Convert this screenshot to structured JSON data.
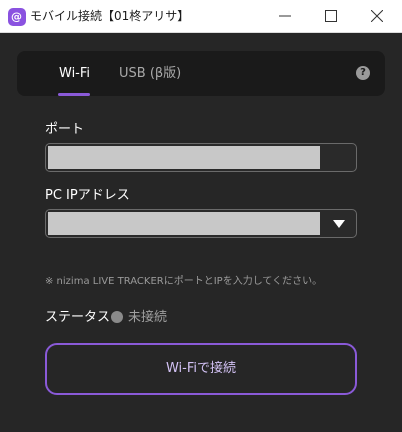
{
  "window": {
    "title": "モバイル接続【01柊アリサ】",
    "app_icon": "nizima-app-icon",
    "app_icon_glyph": "@"
  },
  "tabs": [
    {
      "label": "Wi-Fi",
      "selected": true
    },
    {
      "label": "USB (β版)",
      "selected": false
    }
  ],
  "help": {
    "icon": "question-icon",
    "glyph": "?"
  },
  "form": {
    "port": {
      "label": "ポート",
      "value": "",
      "placeholder": ""
    },
    "pc_ip": {
      "label": "PC IPアドレス",
      "value": "",
      "placeholder": ""
    }
  },
  "note": "※ nizima LIVE TRACKERにポートとIPを入力してください。",
  "status": {
    "label": "ステータス",
    "value": "未接続"
  },
  "connect_button": {
    "label": "Wi-Fiで接続"
  },
  "colors": {
    "accent": "#8a5ad8",
    "background": "#262626",
    "panel": "#1a1a1a"
  }
}
